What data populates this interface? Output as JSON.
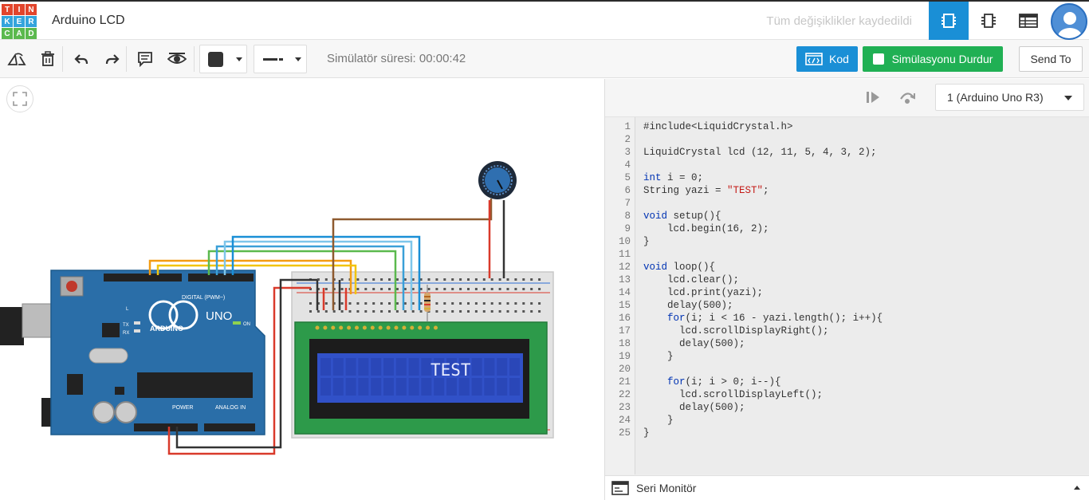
{
  "header": {
    "logo_letters": [
      "T",
      "I",
      "N",
      "K",
      "E",
      "R",
      "C",
      "A",
      "D"
    ],
    "logo_colors": [
      "#e2452c",
      "#e2452c",
      "#e2452c",
      "#34a4dc",
      "#34a4dc",
      "#34a4dc",
      "#5bb94e",
      "#5bb94e",
      "#5bb94e"
    ],
    "project_title": "Arduino LCD",
    "save_status": "Tüm değişiklikler kaydedildi"
  },
  "toolbar": {
    "sim_time": "Simülatör süresi: 00:00:42",
    "code_label": "Kod",
    "stop_label": "Simülasyonu Durdur",
    "send_label": "Send To"
  },
  "code_panel": {
    "device": "1 (Arduino Uno R3)",
    "lines": [
      "#include<LiquidCrystal.h>",
      "",
      "LiquidCrystal lcd (12, 11, 5, 4, 3, 2);",
      "",
      "int i = 0;",
      "String yazi = \"TEST\";",
      "",
      "void setup(){",
      "    lcd.begin(16, 2);",
      "}",
      "",
      "void loop(){",
      "    lcd.clear();",
      "    lcd.print(yazi);",
      "    delay(500);",
      "    for(i; i < 16 - yazi.length(); i++){",
      "      lcd.scrollDisplayRight();",
      "      delay(500);",
      "    }",
      "",
      "    for(i; i > 0; i--){",
      "      lcd.scrollDisplayLeft();",
      "      delay(500);",
      "    }",
      "}"
    ],
    "serial_label": "Seri Monitör"
  },
  "circuit": {
    "board_brand": "ARDUINO",
    "board_model": "UNO",
    "digital_label": "DIGITAL (PWM~)",
    "power_label": "POWER",
    "analog_label": "ANALOG IN",
    "lcd_text": "TEST",
    "on_label": "ON",
    "tx_label": "TX",
    "rx_label": "RX",
    "l_label": "L"
  }
}
